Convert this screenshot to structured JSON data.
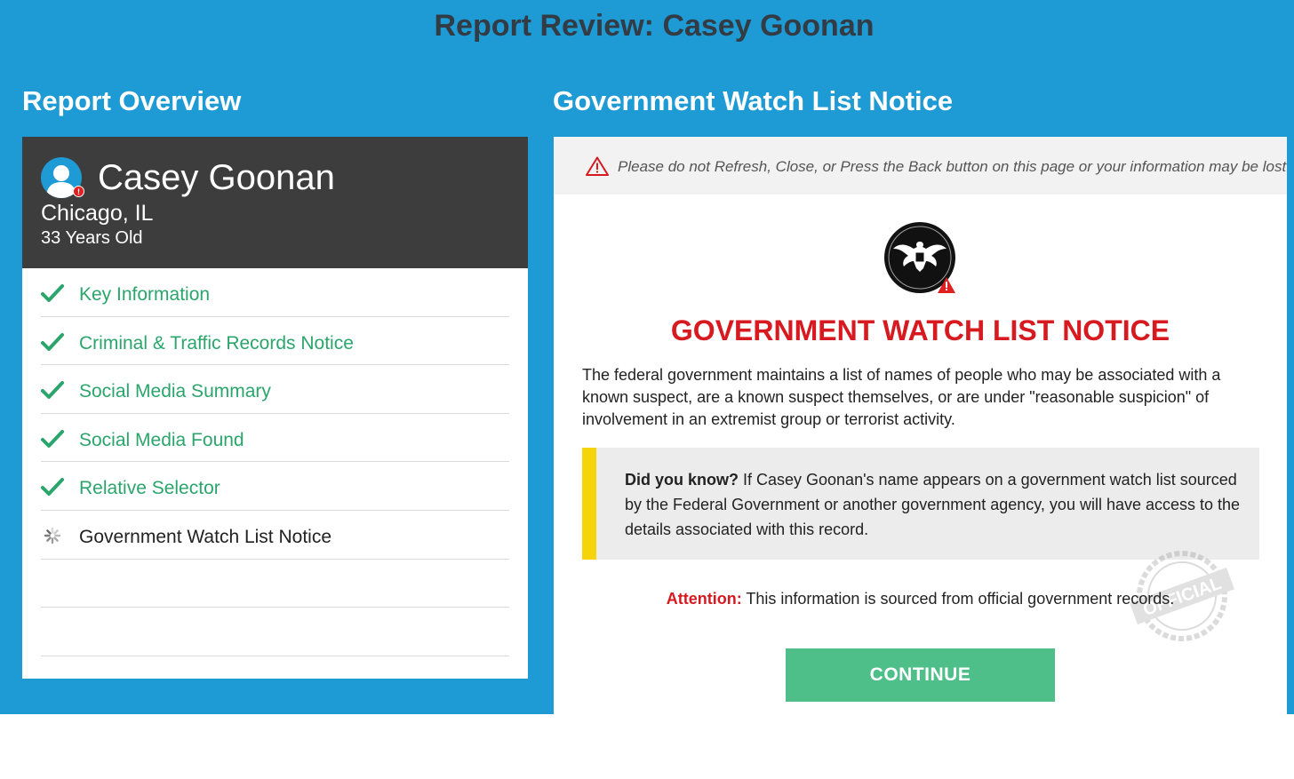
{
  "page": {
    "title_prefix": "Report Review: ",
    "title_name": "Casey Goonan"
  },
  "left": {
    "heading": "Report Overview",
    "profile": {
      "name": "Casey Goonan",
      "location": "Chicago, IL",
      "age": "33 Years Old",
      "badge": "!"
    },
    "checklist": [
      {
        "label": "Key Information",
        "status": "done"
      },
      {
        "label": "Criminal & Traffic Records Notice",
        "status": "done"
      },
      {
        "label": "Social Media Summary",
        "status": "done"
      },
      {
        "label": "Social Media Found",
        "status": "done"
      },
      {
        "label": "Relative Selector",
        "status": "done"
      },
      {
        "label": "Government Watch List Notice",
        "status": "loading"
      },
      {
        "label": "",
        "status": "empty"
      },
      {
        "label": "",
        "status": "empty"
      }
    ]
  },
  "right": {
    "heading": "Government Watch List Notice",
    "warning": "Please do not Refresh, Close, or Press the Back button on this page or your information may be lost",
    "notice_title": "GOVERNMENT WATCH LIST NOTICE",
    "notice_body": "The federal government maintains a list of names of people who may be associated with a known suspect, are a known suspect themselves, or are under \"reasonable suspicion\" of involvement in an extremist group or terrorist activity.",
    "did_you_know_label": "Did you know?",
    "did_you_know_text": " If Casey Goonan's name appears on a government watch list sourced by the Federal Government or another government agency, you will have access to the details associated with this record.",
    "attention_label": "Attention:",
    "attention_text": " This information is sourced from official government records.",
    "stamp_text": "OFFICIAL",
    "continue_label": "CONTINUE"
  },
  "colors": {
    "background_blue": "#1e9ad4",
    "check_green": "#2ba56b",
    "notice_red": "#d71920",
    "callout_yellow": "#f6d40a",
    "button_green": "#4fbf8a"
  },
  "icons": {
    "done": "check-icon",
    "loading": "spinner-icon",
    "warning": "warning-triangle-icon",
    "seal": "eagle-seal-icon",
    "avatar": "user-avatar-icon"
  }
}
